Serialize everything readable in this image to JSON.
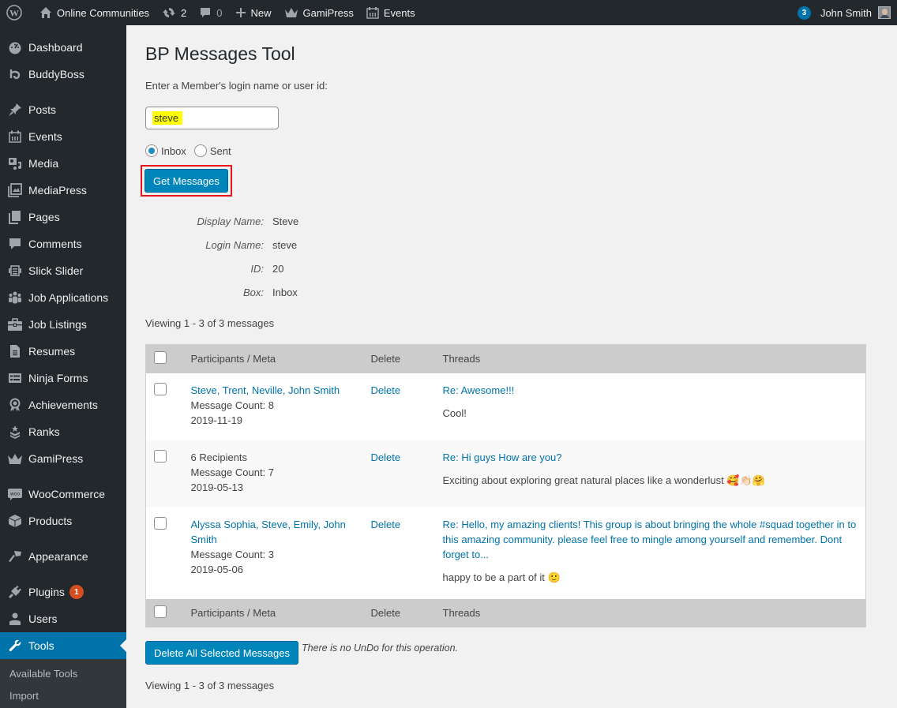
{
  "adminbar": {
    "site_name": "Online Communities",
    "updates_count": "2",
    "comments_count": "0",
    "new_label": "New",
    "gamipress_label": "GamiPress",
    "events_label": "Events",
    "notifications_count": "3",
    "user_name": "John Smith"
  },
  "sidebar": {
    "items": [
      {
        "label": "Dashboard",
        "icon": "dashboard-icon"
      },
      {
        "label": "BuddyBoss",
        "icon": "buddyboss-icon"
      },
      {
        "label": "Posts",
        "icon": "pin-icon"
      },
      {
        "label": "Events",
        "icon": "calendar-icon"
      },
      {
        "label": "Media",
        "icon": "media-icon"
      },
      {
        "label": "MediaPress",
        "icon": "gallery-icon"
      },
      {
        "label": "Pages",
        "icon": "pages-icon"
      },
      {
        "label": "Comments",
        "icon": "comment-icon"
      },
      {
        "label": "Slick Slider",
        "icon": "slider-icon"
      },
      {
        "label": "Job Applications",
        "icon": "groups-icon"
      },
      {
        "label": "Job Listings",
        "icon": "briefcase-icon"
      },
      {
        "label": "Resumes",
        "icon": "document-icon"
      },
      {
        "label": "Ninja Forms",
        "icon": "form-icon"
      },
      {
        "label": "Achievements",
        "icon": "award-icon"
      },
      {
        "label": "Ranks",
        "icon": "rank-icon"
      },
      {
        "label": "GamiPress",
        "icon": "crown-icon"
      },
      {
        "label": "WooCommerce",
        "icon": "woo-icon"
      },
      {
        "label": "Products",
        "icon": "box-icon"
      },
      {
        "label": "Appearance",
        "icon": "brush-icon"
      },
      {
        "label": "Plugins",
        "icon": "plug-icon",
        "badge": "1"
      },
      {
        "label": "Users",
        "icon": "user-icon"
      },
      {
        "label": "Tools",
        "icon": "wrench-icon",
        "active": true
      }
    ],
    "submenu": [
      "Available Tools",
      "Import"
    ]
  },
  "page": {
    "title": "BP Messages Tool",
    "prompt": "Enter a Member's login name or user id:",
    "login_value": "steve",
    "radio_inbox": "Inbox",
    "radio_sent": "Sent",
    "selected_box": "Inbox",
    "get_button": "Get Messages",
    "info": [
      {
        "key": "Display Name:",
        "value": "Steve"
      },
      {
        "key": "Login Name:",
        "value": "steve"
      },
      {
        "key": "ID:",
        "value": "20"
      },
      {
        "key": "Box:",
        "value": "Inbox"
      }
    ],
    "viewing": "Viewing 1 - 3 of 3 messages",
    "table": {
      "headers": [
        "Participants / Meta",
        "Delete",
        "Threads"
      ],
      "rows": [
        {
          "participants": "Steve, Trent, Neville, John Smith",
          "participants_link": true,
          "count": "Message Count: 8",
          "date": "2019-11-19",
          "delete": "Delete",
          "thread_title": "Re: Awesome!!!",
          "thread_body": "Cool!"
        },
        {
          "participants": "6 Recipients",
          "participants_link": false,
          "count": "Message Count: 7",
          "date": "2019-05-13",
          "delete": "Delete",
          "thread_title": "Re: Hi guys How are you?",
          "thread_body": "Exciting about exploring great natural places like a wonderlust 🥰👏🏻🤗"
        },
        {
          "participants": "Alyssa Sophia, Steve, Emily, John Smith",
          "participants_link": true,
          "count": "Message Count: 3",
          "date": "2019-05-06",
          "delete": "Delete",
          "thread_title": "Re: Hello, my amazing clients! This group is about bringing the whole #squad together in to this amazing community. please feel free to mingle among yourself and remember. Dont forget to...",
          "thread_body": "happy to be a part of it 🙂"
        }
      ]
    },
    "delete_all_button": "Delete All Selected Messages",
    "undo_note": "There is no UnDo for this operation."
  },
  "colors": {
    "accent": "#0073aa",
    "button": "#0085ba",
    "adminbar": "#23282d",
    "highlight": "#ffff00",
    "annotation_border": "#e8141b",
    "plugin_badge": "#d54e21"
  }
}
